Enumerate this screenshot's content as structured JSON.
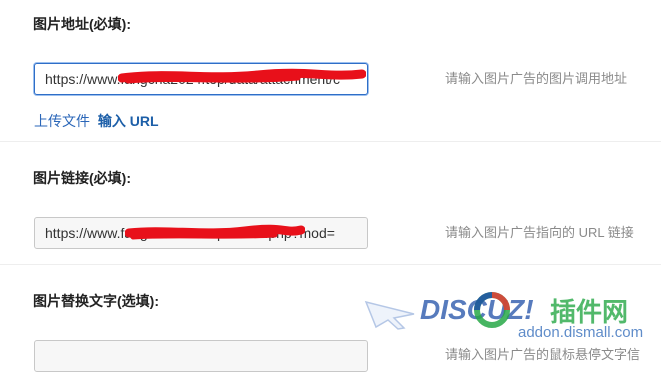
{
  "form": {
    "image_address": {
      "label": "图片地址(必填):",
      "value": "https://www.fangcha2024.top/data/attachment/c",
      "hint": "请输入图片广告的图片调用地址",
      "upload_link": "上传文件",
      "url_link": "输入 URL"
    },
    "image_link": {
      "label": "图片链接(必填):",
      "value": "https://www.fangcha2024.top/forum.php?mod=",
      "hint": "请输入图片广告指向的 URL 链接"
    },
    "alt_text": {
      "label": "图片替换文字(选填):",
      "value": "",
      "hint": "请输入图片广告的鼠标悬停文字信"
    }
  },
  "watermark": {
    "brand": "DISCUZ!",
    "cn": "插件网",
    "domain": "addon.dismall.com"
  },
  "colors": {
    "accent": "#2f6ec7",
    "link": "#2a66b8",
    "redaction": "#e8101a",
    "watermark_blue": "#1f4fa8",
    "watermark_green": "#27a847"
  }
}
